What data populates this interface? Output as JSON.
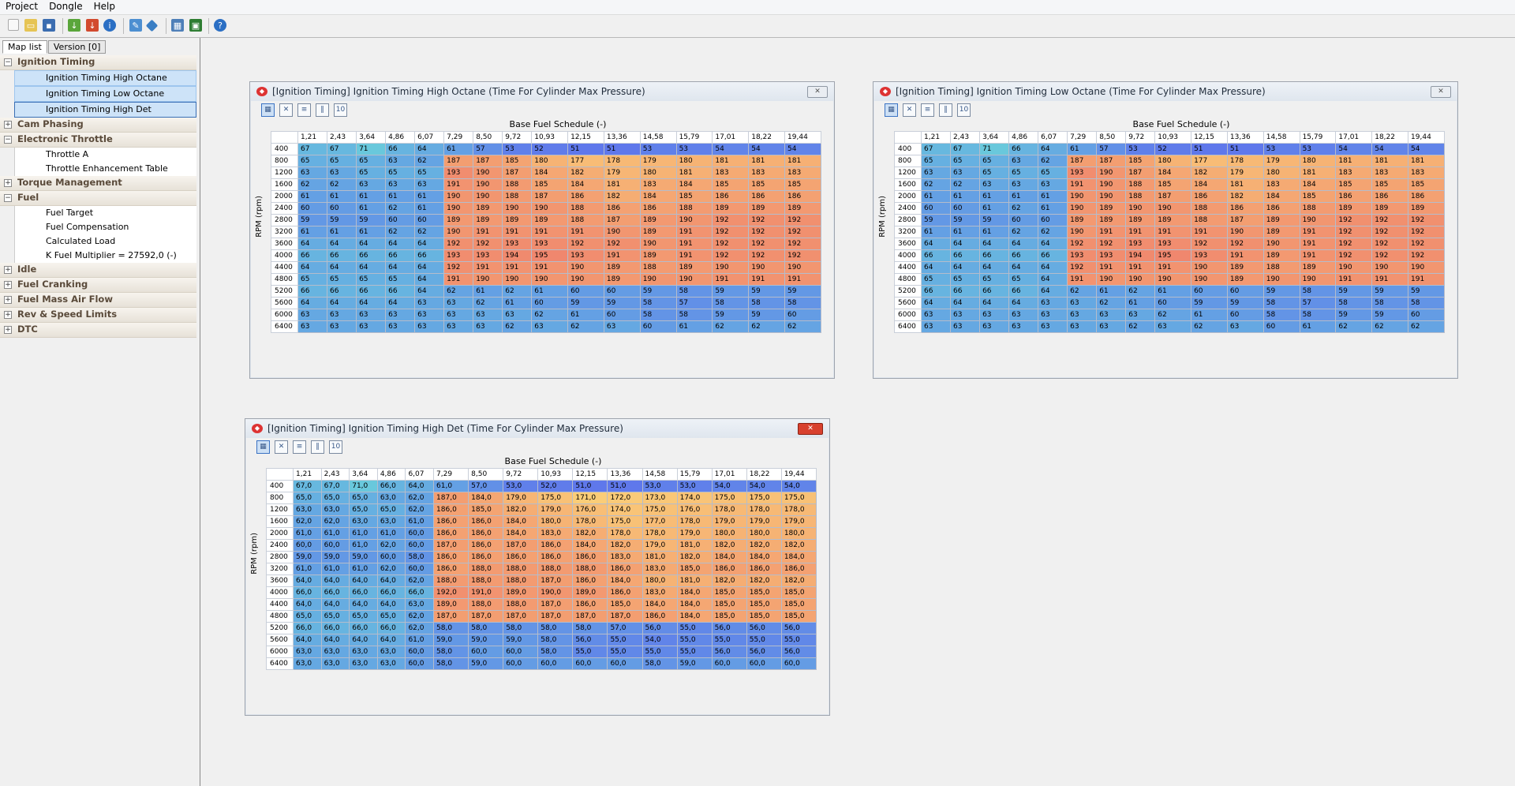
{
  "menu": [
    "Project",
    "Dongle",
    "Help"
  ],
  "toolbar": {
    "icons": [
      "new-icon",
      "open-icon",
      "save-icon",
      "download-icon",
      "upload-icon",
      "info-icon",
      "wrench-icon",
      "chip-icon",
      "table-icon",
      "monitor-icon",
      "help-icon"
    ]
  },
  "left": {
    "tabs": [
      "Map list",
      "Version [0]"
    ],
    "tree": [
      {
        "type": "group",
        "label": "Ignition Timing",
        "pm": "−"
      },
      {
        "type": "item",
        "label": "Ignition Timing High Octane",
        "sel": 1
      },
      {
        "type": "item",
        "label": "Ignition Timing Low Octane",
        "sel": 1
      },
      {
        "type": "item",
        "label": "Ignition Timing High Det",
        "sel": 2
      },
      {
        "type": "group",
        "label": "Cam Phasing",
        "pm": "+"
      },
      {
        "type": "group",
        "label": "Electronic Throttle",
        "pm": "−"
      },
      {
        "type": "item",
        "label": "Throttle A"
      },
      {
        "type": "item",
        "label": "Throttle Enhancement Table"
      },
      {
        "type": "group",
        "label": "Torque Management",
        "pm": "+"
      },
      {
        "type": "group",
        "label": "Fuel",
        "pm": "−"
      },
      {
        "type": "item",
        "label": "Fuel Target"
      },
      {
        "type": "item",
        "label": "Fuel Compensation"
      },
      {
        "type": "item",
        "label": "Calculated Load"
      },
      {
        "type": "item",
        "label": "K Fuel Multiplier = 27592,0 (-)"
      },
      {
        "type": "group",
        "label": "Idle",
        "pm": "+"
      },
      {
        "type": "group",
        "label": "Fuel Cranking",
        "pm": "+"
      },
      {
        "type": "group",
        "label": "Fuel Mass Air Flow",
        "pm": "+"
      },
      {
        "type": "group",
        "label": "Rev & Speed Limits",
        "pm": "+"
      },
      {
        "type": "group",
        "label": "DTC",
        "pm": "+"
      }
    ]
  },
  "windows": [
    {
      "title": "[Ignition Timing] Ignition Timing High Octane (Time For Cylinder Max Pressure)",
      "xaxis": "Base Fuel Schedule (-)",
      "yaxis": "RPM (rpm)",
      "close_style": "normal",
      "cols": [
        "1,21",
        "2,43",
        "3,64",
        "4,86",
        "6,07",
        "7,29",
        "8,50",
        "9,72",
        "10,93",
        "12,15",
        "13,36",
        "14,58",
        "15,79",
        "17,01",
        "18,22",
        "19,44"
      ],
      "rows": [
        "400",
        "800",
        "1200",
        "1600",
        "2000",
        "2400",
        "2800",
        "3200",
        "3600",
        "4000",
        "4400",
        "4800",
        "5200",
        "5600",
        "6000",
        "6400"
      ],
      "values": [
        [
          "67",
          "67",
          "71",
          "66",
          "64",
          "61",
          "57",
          "53",
          "52",
          "51",
          "51",
          "53",
          "53",
          "54",
          "54",
          "54"
        ],
        [
          "65",
          "65",
          "65",
          "63",
          "62",
          "187",
          "187",
          "185",
          "180",
          "177",
          "178",
          "179",
          "180",
          "181",
          "181",
          "181"
        ],
        [
          "63",
          "63",
          "65",
          "65",
          "65",
          "193",
          "190",
          "187",
          "184",
          "182",
          "179",
          "180",
          "181",
          "183",
          "183",
          "183"
        ],
        [
          "62",
          "62",
          "63",
          "63",
          "63",
          "191",
          "190",
          "188",
          "185",
          "184",
          "181",
          "183",
          "184",
          "185",
          "185",
          "185"
        ],
        [
          "61",
          "61",
          "61",
          "61",
          "61",
          "190",
          "190",
          "188",
          "187",
          "186",
          "182",
          "184",
          "185",
          "186",
          "186",
          "186"
        ],
        [
          "60",
          "60",
          "61",
          "62",
          "61",
          "190",
          "189",
          "190",
          "190",
          "188",
          "186",
          "186",
          "188",
          "189",
          "189",
          "189"
        ],
        [
          "59",
          "59",
          "59",
          "60",
          "60",
          "189",
          "189",
          "189",
          "189",
          "188",
          "187",
          "189",
          "190",
          "192",
          "192",
          "192"
        ],
        [
          "61",
          "61",
          "61",
          "62",
          "62",
          "190",
          "191",
          "191",
          "191",
          "191",
          "190",
          "189",
          "191",
          "192",
          "192",
          "192"
        ],
        [
          "64",
          "64",
          "64",
          "64",
          "64",
          "192",
          "192",
          "193",
          "193",
          "192",
          "192",
          "190",
          "191",
          "192",
          "192",
          "192"
        ],
        [
          "66",
          "66",
          "66",
          "66",
          "66",
          "193",
          "193",
          "194",
          "195",
          "193",
          "191",
          "189",
          "191",
          "192",
          "192",
          "192"
        ],
        [
          "64",
          "64",
          "64",
          "64",
          "64",
          "192",
          "191",
          "191",
          "191",
          "190",
          "189",
          "188",
          "189",
          "190",
          "190",
          "190"
        ],
        [
          "65",
          "65",
          "65",
          "65",
          "64",
          "191",
          "190",
          "190",
          "190",
          "190",
          "189",
          "190",
          "190",
          "191",
          "191",
          "191"
        ],
        [
          "66",
          "66",
          "66",
          "66",
          "64",
          "62",
          "61",
          "62",
          "61",
          "60",
          "60",
          "59",
          "58",
          "59",
          "59",
          "59"
        ],
        [
          "64",
          "64",
          "64",
          "64",
          "63",
          "63",
          "62",
          "61",
          "60",
          "59",
          "59",
          "58",
          "57",
          "58",
          "58",
          "58"
        ],
        [
          "63",
          "63",
          "63",
          "63",
          "63",
          "63",
          "63",
          "63",
          "62",
          "61",
          "60",
          "58",
          "58",
          "59",
          "59",
          "60"
        ],
        [
          "63",
          "63",
          "63",
          "63",
          "63",
          "63",
          "63",
          "62",
          "63",
          "62",
          "63",
          "60",
          "61",
          "62",
          "62",
          "62"
        ]
      ]
    },
    {
      "title": "[Ignition Timing] Ignition Timing Low Octane (Time For Cylinder Max Pressure)",
      "xaxis": "Base Fuel Schedule (-)",
      "yaxis": "RPM (rpm)",
      "close_style": "normal",
      "cols": [
        "1,21",
        "2,43",
        "3,64",
        "4,86",
        "6,07",
        "7,29",
        "8,50",
        "9,72",
        "10,93",
        "12,15",
        "13,36",
        "14,58",
        "15,79",
        "17,01",
        "18,22",
        "19,44"
      ],
      "rows": [
        "400",
        "800",
        "1200",
        "1600",
        "2000",
        "2400",
        "2800",
        "3200",
        "3600",
        "4000",
        "4400",
        "4800",
        "5200",
        "5600",
        "6000",
        "6400"
      ],
      "values": [
        [
          "67",
          "67",
          "71",
          "66",
          "64",
          "61",
          "57",
          "53",
          "52",
          "51",
          "51",
          "53",
          "53",
          "54",
          "54",
          "54"
        ],
        [
          "65",
          "65",
          "65",
          "63",
          "62",
          "187",
          "187",
          "185",
          "180",
          "177",
          "178",
          "179",
          "180",
          "181",
          "181",
          "181"
        ],
        [
          "63",
          "63",
          "65",
          "65",
          "65",
          "193",
          "190",
          "187",
          "184",
          "182",
          "179",
          "180",
          "181",
          "183",
          "183",
          "183"
        ],
        [
          "62",
          "62",
          "63",
          "63",
          "63",
          "191",
          "190",
          "188",
          "185",
          "184",
          "181",
          "183",
          "184",
          "185",
          "185",
          "185"
        ],
        [
          "61",
          "61",
          "61",
          "61",
          "61",
          "190",
          "190",
          "188",
          "187",
          "186",
          "182",
          "184",
          "185",
          "186",
          "186",
          "186"
        ],
        [
          "60",
          "60",
          "61",
          "62",
          "61",
          "190",
          "189",
          "190",
          "190",
          "188",
          "186",
          "186",
          "188",
          "189",
          "189",
          "189"
        ],
        [
          "59",
          "59",
          "59",
          "60",
          "60",
          "189",
          "189",
          "189",
          "189",
          "188",
          "187",
          "189",
          "190",
          "192",
          "192",
          "192"
        ],
        [
          "61",
          "61",
          "61",
          "62",
          "62",
          "190",
          "191",
          "191",
          "191",
          "191",
          "190",
          "189",
          "191",
          "192",
          "192",
          "192"
        ],
        [
          "64",
          "64",
          "64",
          "64",
          "64",
          "192",
          "192",
          "193",
          "193",
          "192",
          "192",
          "190",
          "191",
          "192",
          "192",
          "192"
        ],
        [
          "66",
          "66",
          "66",
          "66",
          "66",
          "193",
          "193",
          "194",
          "195",
          "193",
          "191",
          "189",
          "191",
          "192",
          "192",
          "192"
        ],
        [
          "64",
          "64",
          "64",
          "64",
          "64",
          "192",
          "191",
          "191",
          "191",
          "190",
          "189",
          "188",
          "189",
          "190",
          "190",
          "190"
        ],
        [
          "65",
          "65",
          "65",
          "65",
          "64",
          "191",
          "190",
          "190",
          "190",
          "190",
          "189",
          "190",
          "190",
          "191",
          "191",
          "191"
        ],
        [
          "66",
          "66",
          "66",
          "66",
          "64",
          "62",
          "61",
          "62",
          "61",
          "60",
          "60",
          "59",
          "58",
          "59",
          "59",
          "59"
        ],
        [
          "64",
          "64",
          "64",
          "64",
          "63",
          "63",
          "62",
          "61",
          "60",
          "59",
          "59",
          "58",
          "57",
          "58",
          "58",
          "58"
        ],
        [
          "63",
          "63",
          "63",
          "63",
          "63",
          "63",
          "63",
          "63",
          "62",
          "61",
          "60",
          "58",
          "58",
          "59",
          "59",
          "60"
        ],
        [
          "63",
          "63",
          "63",
          "63",
          "63",
          "63",
          "63",
          "62",
          "63",
          "62",
          "63",
          "60",
          "61",
          "62",
          "62",
          "62"
        ]
      ]
    },
    {
      "title": "[Ignition Timing] Ignition Timing High Det (Time For Cylinder Max Pressure)",
      "xaxis": "Base Fuel Schedule (-)",
      "yaxis": "RPM (rpm)",
      "close_style": "red",
      "cols": [
        "1,21",
        "2,43",
        "3,64",
        "4,86",
        "6,07",
        "7,29",
        "8,50",
        "9,72",
        "10,93",
        "12,15",
        "13,36",
        "14,58",
        "15,79",
        "17,01",
        "18,22",
        "19,44"
      ],
      "rows": [
        "400",
        "800",
        "1200",
        "1600",
        "2000",
        "2400",
        "2800",
        "3200",
        "3600",
        "4000",
        "4400",
        "4800",
        "5200",
        "5600",
        "6000",
        "6400"
      ],
      "values": [
        [
          "67,0",
          "67,0",
          "71,0",
          "66,0",
          "64,0",
          "61,0",
          "57,0",
          "53,0",
          "52,0",
          "51,0",
          "51,0",
          "53,0",
          "53,0",
          "54,0",
          "54,0",
          "54,0"
        ],
        [
          "65,0",
          "65,0",
          "65,0",
          "63,0",
          "62,0",
          "187,0",
          "184,0",
          "179,0",
          "175,0",
          "171,0",
          "172,0",
          "173,0",
          "174,0",
          "175,0",
          "175,0",
          "175,0"
        ],
        [
          "63,0",
          "63,0",
          "65,0",
          "65,0",
          "62,0",
          "186,0",
          "185,0",
          "182,0",
          "179,0",
          "176,0",
          "174,0",
          "175,0",
          "176,0",
          "178,0",
          "178,0",
          "178,0"
        ],
        [
          "62,0",
          "62,0",
          "63,0",
          "63,0",
          "61,0",
          "186,0",
          "186,0",
          "184,0",
          "180,0",
          "178,0",
          "175,0",
          "177,0",
          "178,0",
          "179,0",
          "179,0",
          "179,0"
        ],
        [
          "61,0",
          "61,0",
          "61,0",
          "61,0",
          "60,0",
          "186,0",
          "186,0",
          "184,0",
          "183,0",
          "182,0",
          "178,0",
          "178,0",
          "179,0",
          "180,0",
          "180,0",
          "180,0"
        ],
        [
          "60,0",
          "60,0",
          "61,0",
          "62,0",
          "60,0",
          "187,0",
          "186,0",
          "187,0",
          "186,0",
          "184,0",
          "182,0",
          "179,0",
          "181,0",
          "182,0",
          "182,0",
          "182,0"
        ],
        [
          "59,0",
          "59,0",
          "59,0",
          "60,0",
          "58,0",
          "186,0",
          "186,0",
          "186,0",
          "186,0",
          "186,0",
          "183,0",
          "181,0",
          "182,0",
          "184,0",
          "184,0",
          "184,0"
        ],
        [
          "61,0",
          "61,0",
          "61,0",
          "62,0",
          "60,0",
          "186,0",
          "188,0",
          "188,0",
          "188,0",
          "188,0",
          "186,0",
          "183,0",
          "185,0",
          "186,0",
          "186,0",
          "186,0"
        ],
        [
          "64,0",
          "64,0",
          "64,0",
          "64,0",
          "62,0",
          "188,0",
          "188,0",
          "188,0",
          "187,0",
          "186,0",
          "184,0",
          "180,0",
          "181,0",
          "182,0",
          "182,0",
          "182,0"
        ],
        [
          "66,0",
          "66,0",
          "66,0",
          "66,0",
          "66,0",
          "192,0",
          "191,0",
          "189,0",
          "190,0",
          "189,0",
          "186,0",
          "183,0",
          "184,0",
          "185,0",
          "185,0",
          "185,0"
        ],
        [
          "64,0",
          "64,0",
          "64,0",
          "64,0",
          "63,0",
          "189,0",
          "188,0",
          "188,0",
          "187,0",
          "186,0",
          "185,0",
          "184,0",
          "184,0",
          "185,0",
          "185,0",
          "185,0"
        ],
        [
          "65,0",
          "65,0",
          "65,0",
          "65,0",
          "62,0",
          "187,0",
          "187,0",
          "187,0",
          "187,0",
          "187,0",
          "187,0",
          "186,0",
          "184,0",
          "185,0",
          "185,0",
          "185,0"
        ],
        [
          "66,0",
          "66,0",
          "66,0",
          "66,0",
          "62,0",
          "58,0",
          "58,0",
          "58,0",
          "58,0",
          "58,0",
          "57,0",
          "56,0",
          "55,0",
          "56,0",
          "56,0",
          "56,0"
        ],
        [
          "64,0",
          "64,0",
          "64,0",
          "64,0",
          "61,0",
          "59,0",
          "59,0",
          "59,0",
          "58,0",
          "56,0",
          "55,0",
          "54,0",
          "55,0",
          "55,0",
          "55,0",
          "55,0"
        ],
        [
          "63,0",
          "63,0",
          "63,0",
          "63,0",
          "60,0",
          "58,0",
          "60,0",
          "60,0",
          "58,0",
          "55,0",
          "55,0",
          "55,0",
          "55,0",
          "56,0",
          "56,0",
          "56,0"
        ],
        [
          "63,0",
          "63,0",
          "63,0",
          "63,0",
          "60,0",
          "58,0",
          "59,0",
          "60,0",
          "60,0",
          "60,0",
          "60,0",
          "58,0",
          "59,0",
          "60,0",
          "60,0",
          "60,0"
        ]
      ]
    }
  ]
}
